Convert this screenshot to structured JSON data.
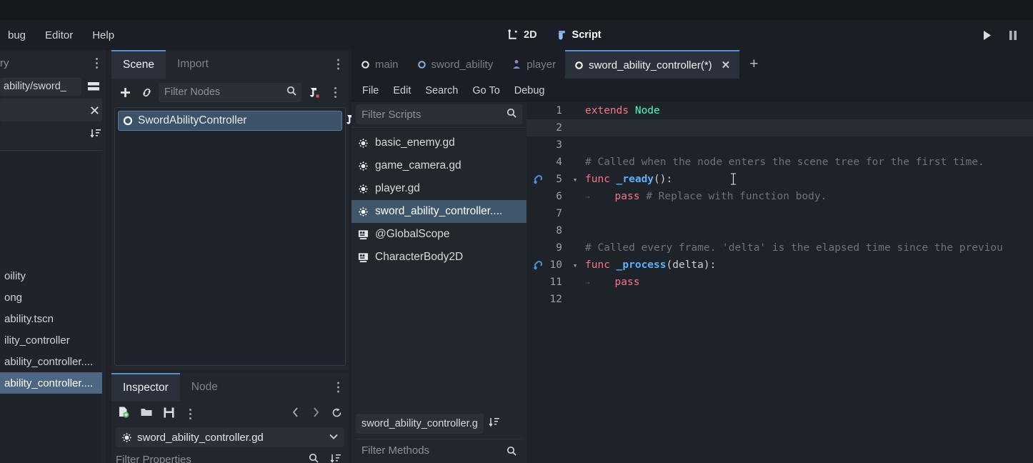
{
  "topbar": {
    "menus": [
      "bug",
      "Editor",
      "Help"
    ],
    "modes": [
      {
        "label": "2D",
        "icon": "2d-icon",
        "active": false
      },
      {
        "label": "Script",
        "icon": "script-icon",
        "active": true
      }
    ],
    "play_buttons": [
      {
        "name": "play-button",
        "glyph": "▶"
      },
      {
        "name": "pause-button",
        "glyph": "❚❚"
      }
    ]
  },
  "leftpanel": {
    "tab_label": "ry",
    "path_value": "ability/sword_",
    "files": [
      {
        "label": "oility",
        "selected": false
      },
      {
        "label": "ong",
        "selected": false
      },
      {
        "label": "ability.tscn",
        "selected": false
      },
      {
        "label": "ility_controller",
        "selected": false
      },
      {
        "label": "ability_controller....",
        "selected": false
      },
      {
        "label": "ability_controller....",
        "selected": true
      }
    ]
  },
  "scene_dock": {
    "tabs": [
      {
        "label": "Scene",
        "active": true
      },
      {
        "label": "Import",
        "active": false
      }
    ],
    "toolbar": {
      "add_icon": "plus-icon",
      "link_icon": "link-icon",
      "filter_placeholder": "Filter Nodes",
      "search_icon": "search-icon",
      "script_icon": "attach-script-icon",
      "kebab_icon": "more-options-icon"
    },
    "tree": [
      {
        "label": "SwordAbilityController",
        "selected": true,
        "icon": "node-icon"
      }
    ]
  },
  "inspector_dock": {
    "tabs": [
      {
        "label": "Inspector",
        "active": true
      },
      {
        "label": "Node",
        "active": false
      }
    ],
    "toolbar_icons": [
      "new-resource-icon",
      "open-folder-icon",
      "save-icon",
      "more-options-icon",
      "history-back-icon",
      "history-forward-icon",
      "history-icon"
    ],
    "object_name": "sword_ability_controller.gd",
    "object_icon": "script-gear-icon",
    "dropdown_icon": "chevron-down-icon",
    "doc_icon": "open-docs-icon",
    "filter_placeholder": "Filter Properties",
    "search_icon": "search-icon",
    "sort_icon": "object-tools-icon"
  },
  "script_editor": {
    "tabs": [
      {
        "label": "main",
        "icon": "node-icon",
        "active": false,
        "closable": false
      },
      {
        "label": "sword_ability",
        "icon": "node-icon",
        "active": false,
        "closable": false
      },
      {
        "label": "player",
        "icon": "character-icon",
        "active": false,
        "closable": false
      },
      {
        "label": "sword_ability_controller(*)",
        "icon": "node-icon",
        "active": true,
        "closable": true
      }
    ],
    "add_tab_label": "+",
    "close_label": "✕",
    "menu": [
      "File",
      "Edit",
      "Search",
      "Go To",
      "Debug"
    ],
    "script_list": {
      "filter_placeholder": "Filter Scripts",
      "search_icon": "search-icon",
      "items": [
        {
          "label": "basic_enemy.gd",
          "icon": "script-gear-icon",
          "selected": false
        },
        {
          "label": "game_camera.gd",
          "icon": "script-gear-icon",
          "selected": false
        },
        {
          "label": "player.gd",
          "icon": "script-gear-icon",
          "selected": false
        },
        {
          "label": "sword_ability_controller....",
          "icon": "script-gear-icon",
          "selected": true
        },
        {
          "label": "@GlobalScope",
          "icon": "doc-icon",
          "selected": false
        },
        {
          "label": "CharacterBody2D",
          "icon": "doc-icon",
          "selected": false
        }
      ],
      "current_file": "sword_ability_controller.g",
      "current_file_sort_icon": "sort-icon",
      "methods_placeholder": "Filter Methods",
      "methods_search_icon": "search-icon"
    },
    "code": {
      "language": "gdscript",
      "current_line": 2,
      "lines": [
        {
          "n": 1,
          "fold": "",
          "mark": "",
          "tokens": [
            {
              "t": "extends ",
              "c": "kw"
            },
            {
              "t": "Node",
              "c": "type"
            }
          ]
        },
        {
          "n": 2,
          "fold": "",
          "mark": "",
          "tokens": []
        },
        {
          "n": 3,
          "fold": "",
          "mark": "",
          "tokens": []
        },
        {
          "n": 4,
          "fold": "",
          "mark": "",
          "tokens": [
            {
              "t": "# Called when the node enters the scene tree for the first time.",
              "c": "comment"
            }
          ]
        },
        {
          "n": 5,
          "fold": "v",
          "mark": "connection",
          "tokens": [
            {
              "t": "func ",
              "c": "kw"
            },
            {
              "t": "_ready",
              "c": "fn"
            },
            {
              "t": "():",
              "c": "plain"
            }
          ]
        },
        {
          "n": 6,
          "fold": "",
          "mark": "",
          "tokens": [
            {
              "t": "→",
              "c": "tab"
            },
            {
              "t": "    pass ",
              "c": "kw"
            },
            {
              "t": "# Replace with function body.",
              "c": "comment"
            }
          ]
        },
        {
          "n": 7,
          "fold": "",
          "mark": "",
          "tokens": []
        },
        {
          "n": 8,
          "fold": "",
          "mark": "",
          "tokens": []
        },
        {
          "n": 9,
          "fold": "",
          "mark": "",
          "tokens": [
            {
              "t": "# Called every frame. 'delta' is the elapsed time since the previou",
              "c": "comment"
            }
          ]
        },
        {
          "n": 10,
          "fold": "v",
          "mark": "connection",
          "tokens": [
            {
              "t": "func ",
              "c": "kw"
            },
            {
              "t": "_process",
              "c": "fn"
            },
            {
              "t": "(delta):",
              "c": "plain"
            }
          ]
        },
        {
          "n": 11,
          "fold": "",
          "mark": "",
          "tokens": [
            {
              "t": "→",
              "c": "tab"
            },
            {
              "t": "    pass",
              "c": "kw"
            }
          ]
        },
        {
          "n": 12,
          "fold": "",
          "mark": "",
          "tokens": []
        }
      ]
    }
  },
  "colors": {
    "accent": "#5a8fd6",
    "selection": "#3f566b",
    "keyword": "#ff7085",
    "type": "#42ffc2",
    "function": "#57b3ff",
    "comment": "#6b737d",
    "editor_bg": "#1e2229",
    "panel_bg": "#22262d"
  }
}
